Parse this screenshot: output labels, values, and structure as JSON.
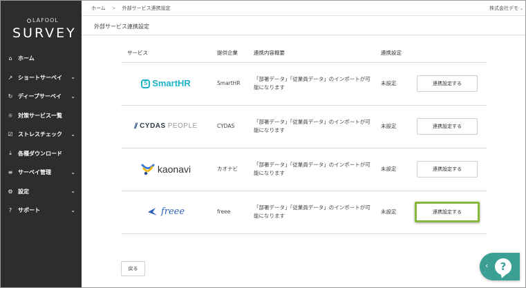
{
  "brand": {
    "small": "LAFOOL",
    "big": "SURVEY"
  },
  "sidebar": {
    "items": [
      {
        "label": "ホーム",
        "icon": "home-icon",
        "glyph": "⌂",
        "chevron": false
      },
      {
        "label": "ショートサーベイ",
        "icon": "trend-icon",
        "glyph": "↗",
        "chevron": true
      },
      {
        "label": "ディープサーベイ",
        "icon": "refresh-icon",
        "glyph": "↻",
        "chevron": true
      },
      {
        "label": "対策サービス一覧",
        "icon": "lightbulb-icon",
        "glyph": "☼",
        "chevron": false
      },
      {
        "label": "ストレスチェック",
        "icon": "checkbox-icon",
        "glyph": "☑",
        "chevron": true
      },
      {
        "label": "各種ダウンロード",
        "icon": "download-icon",
        "glyph": "⤓",
        "chevron": false
      },
      {
        "label": "サーベイ管理",
        "icon": "list-icon",
        "glyph": "≡",
        "chevron": true
      },
      {
        "label": "設定",
        "icon": "gear-icon",
        "glyph": "⚙",
        "chevron": true
      },
      {
        "label": "サポート",
        "icon": "question-icon",
        "glyph": "?",
        "chevron": true
      }
    ]
  },
  "topbar": {
    "breadcrumb_home": "ホーム",
    "breadcrumb_sep": ">",
    "breadcrumb_current": "外部サービス連携設定",
    "company": "株式会社デモ"
  },
  "page": {
    "title": "外部サービス連携設定"
  },
  "table": {
    "headers": {
      "service": "サービス",
      "company": "提供企業",
      "description": "連携内容概要",
      "status": "連携設定"
    },
    "rows": [
      {
        "logo": "smarthr",
        "logo_text": "SmartHR",
        "company": "SmartHR",
        "description": "「部署データ」「従業員データ」のインポートが可能になります",
        "status": "未設定",
        "button": "連携設定する",
        "highlight": false
      },
      {
        "logo": "cydas",
        "logo_text_1": "CYDAS",
        "logo_text_2": "PEOPLE",
        "company": "CYDAS",
        "description": "「部署データ」「従業員データ」のインポートが可能になります",
        "status": "未設定",
        "button": "連携設定する",
        "highlight": false
      },
      {
        "logo": "kaonavi",
        "logo_text": "kaonavi",
        "company": "カオナビ",
        "description": "「部署データ」「従業員データ」のインポートが可能になります",
        "status": "未設定",
        "button": "連携設定する",
        "highlight": false
      },
      {
        "logo": "freee",
        "logo_text": "freee",
        "company": "freee",
        "description": "「部署データ」「従業員データ」のインポートが可能になります",
        "status": "未設定",
        "button": "連携設定する",
        "highlight": true
      }
    ]
  },
  "back_button": "戻る",
  "help": {
    "arrow": "‹",
    "glyph": "?"
  },
  "colors": {
    "sidebar_bg": "#2d2d2d",
    "smarthr": "#1ab3c8",
    "freee": "#2b5fb7",
    "highlight": "#86b83a",
    "help_bg": "#3c9f93"
  }
}
